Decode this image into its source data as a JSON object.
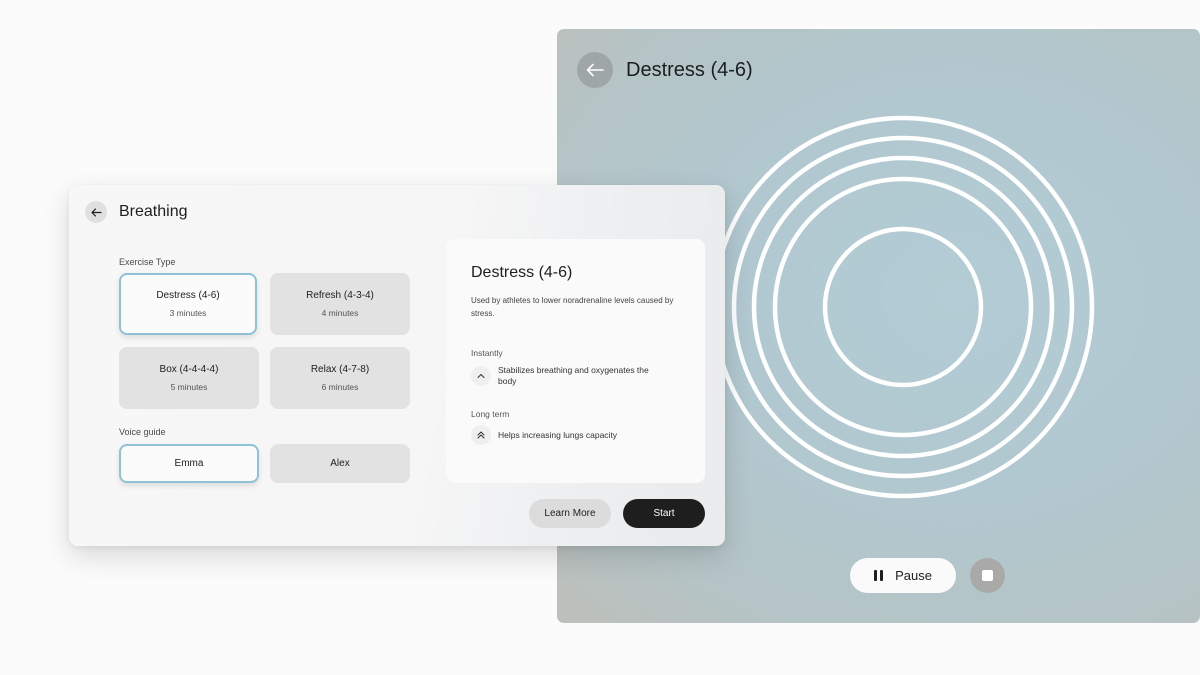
{
  "session": {
    "title": "Destress (4-6)",
    "back_icon": "arrow-left-icon",
    "pause_label": "Pause",
    "pause_icon": "pause-icon",
    "stop_icon": "stop-icon",
    "ring_color": "#ffffff"
  },
  "breathing": {
    "title": "Breathing",
    "back_icon": "arrow-left-icon",
    "exercise_type_label": "Exercise Type",
    "exercises": [
      {
        "name": "Destress (4-6)",
        "duration": "3 minutes",
        "selected": true
      },
      {
        "name": "Refresh (4-3-4)",
        "duration": "4 minutes",
        "selected": false
      },
      {
        "name": "Box (4-4-4-4)",
        "duration": "5 minutes",
        "selected": false
      },
      {
        "name": "Relax (4-7-8)",
        "duration": "6 minutes",
        "selected": false
      }
    ],
    "voice_guide_label": "Voice guide",
    "voices": [
      {
        "name": "Emma",
        "selected": true
      },
      {
        "name": "Alex",
        "selected": false
      }
    ],
    "detail": {
      "title": "Destress (4-6)",
      "description": "Used by athletes to lower noradrenaline levels caused by stress.",
      "instantly_label": "Instantly",
      "instantly_text": "Stabilizes breathing and oxygenates the body",
      "long_term_label": "Long term",
      "long_term_text": "Helps increasing lungs capacity"
    },
    "learn_more_label": "Learn More",
    "start_label": "Start"
  },
  "colors": {
    "accent_selected_border": "#8fc2d6",
    "primary_button": "#1e1e1e",
    "session_background": "#b1c8d0"
  }
}
